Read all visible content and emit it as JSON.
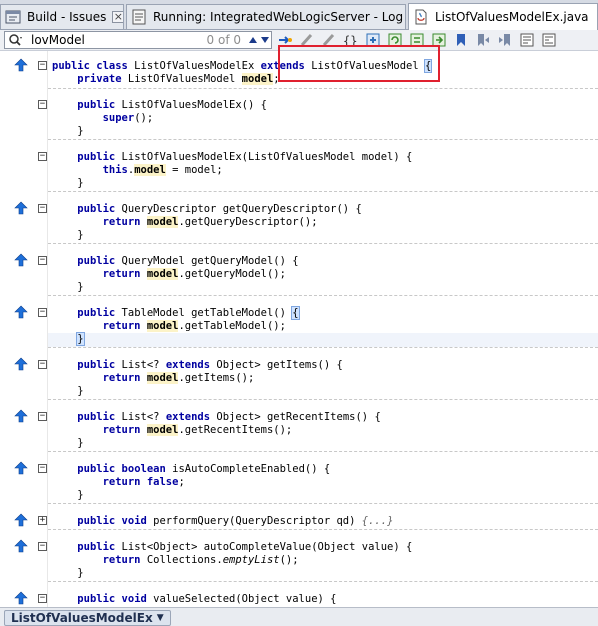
{
  "tabs": [
    {
      "label": "Build - Issues",
      "icon": "build-issues-icon"
    },
    {
      "label": "Running: IntegratedWebLogicServer - Log",
      "icon": "log-icon"
    },
    {
      "label": "ListOfValuesModelEx.java",
      "icon": "java-file-icon"
    }
  ],
  "search": {
    "value": "lovModel",
    "count": "0 of 0"
  },
  "toolbar_icons": [
    "goto-icon",
    "back-icon",
    "forward-icon",
    "brace-match-icon",
    "insert-icon",
    "refresh-icon",
    "sync-icon",
    "nav-icon",
    "bookmark-icon",
    "prev-bookmark-icon",
    "next-bookmark-icon",
    "comment-icon",
    "uncomment-icon"
  ],
  "code_lines": [
    {
      "t": "l1",
      "text": "public class ListOfValuesModelEx extends ListOfValuesModel {"
    },
    {
      "t": "l2",
      "text": "    private ListOfValuesModel model;"
    },
    {
      "t": "l3",
      "text": "    public ListOfValuesModelEx() {"
    },
    {
      "t": "l4",
      "text": "        super();"
    },
    {
      "t": "l5",
      "text": "    }"
    },
    {
      "t": "l6",
      "text": "    public ListOfValuesModelEx(ListOfValuesModel model) {"
    },
    {
      "t": "l7",
      "text": "        this.model = model;"
    },
    {
      "t": "l8",
      "text": "    }"
    },
    {
      "t": "l9",
      "text": "    public QueryDescriptor getQueryDescriptor() {"
    },
    {
      "t": "l10",
      "text": "        return model.getQueryDescriptor();"
    },
    {
      "t": "l11",
      "text": "    }"
    },
    {
      "t": "l12",
      "text": "    public QueryModel getQueryModel() {"
    },
    {
      "t": "l13",
      "text": "        return model.getQueryModel();"
    },
    {
      "t": "l14",
      "text": "    }"
    },
    {
      "t": "l15",
      "text": "    public TableModel getTableModel() {"
    },
    {
      "t": "l16",
      "text": "        return model.getTableModel();"
    },
    {
      "t": "l17",
      "text": "    }"
    },
    {
      "t": "l18",
      "text": "    public List<? extends Object> getItems() {"
    },
    {
      "t": "l19",
      "text": "        return model.getItems();"
    },
    {
      "t": "l20",
      "text": "    }"
    },
    {
      "t": "l21",
      "text": "    public List<? extends Object> getRecentItems() {"
    },
    {
      "t": "l22",
      "text": "        return model.getRecentItems();"
    },
    {
      "t": "l23",
      "text": "    }"
    },
    {
      "t": "l24",
      "text": "    public boolean isAutoCompleteEnabled() {"
    },
    {
      "t": "l25",
      "text": "        return false;"
    },
    {
      "t": "l26",
      "text": "    }"
    },
    {
      "t": "l27",
      "text": "    public void performQuery(QueryDescriptor qd) {...}"
    },
    {
      "t": "l28",
      "text": "    public List<Object> autoCompleteValue(Object value) {"
    },
    {
      "t": "l29",
      "text": "        return Collections.emptyList();"
    },
    {
      "t": "l30",
      "text": "    }"
    },
    {
      "t": "l31",
      "text": "    public void valueSelected(Object value) {"
    }
  ],
  "breadcrumb": {
    "label": "ListOfValuesModelEx"
  },
  "colors": {
    "keyword": "#0000a0",
    "field_highlight": "#fcf3c8",
    "annotation_box": "#e0202f",
    "override_arrow": "#1e6fd9"
  }
}
